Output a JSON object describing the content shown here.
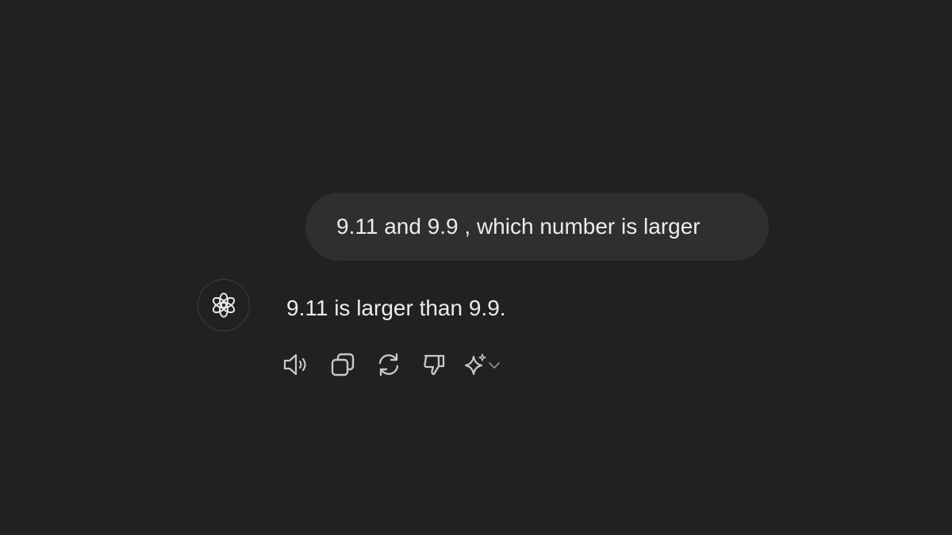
{
  "conversation": {
    "user_message": "9.11 and 9.9 , which number is larger",
    "assistant_message": "9.11 is larger than 9.9."
  },
  "assistant": {
    "avatar_icon": "openai-logo-icon"
  },
  "actions": [
    {
      "name": "read-aloud-button",
      "icon": "speaker-icon"
    },
    {
      "name": "copy-button",
      "icon": "copy-icon"
    },
    {
      "name": "regenerate-button",
      "icon": "refresh-icon"
    },
    {
      "name": "dislike-button",
      "icon": "thumbs-down-icon"
    },
    {
      "name": "change-model-button",
      "icon": "sparkle-icon"
    }
  ],
  "colors": {
    "background": "#212121",
    "bubble": "#2f2f2f",
    "text": "#ececec",
    "icon": "#c8c8c8"
  }
}
